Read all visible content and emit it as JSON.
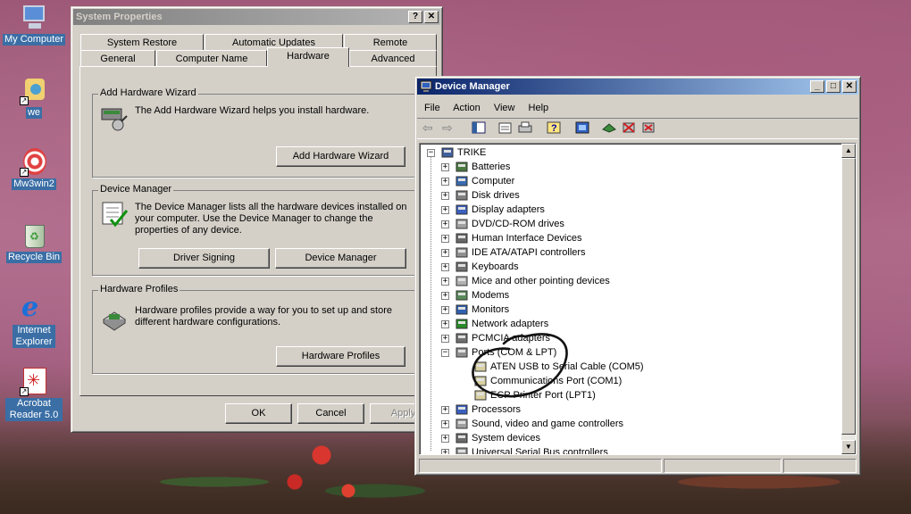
{
  "desktop": {
    "icons": [
      {
        "label": "My Computer"
      },
      {
        "label": "we"
      },
      {
        "label": "Mw3win2"
      },
      {
        "label": "Recycle Bin"
      },
      {
        "label": "Internet Explorer"
      },
      {
        "label": "Acrobat Reader 5.0"
      }
    ]
  },
  "system_properties": {
    "title": "System Properties",
    "tabs_row1": [
      "System Restore",
      "Automatic Updates",
      "Remote"
    ],
    "tabs_row2": [
      "General",
      "Computer Name",
      "Hardware",
      "Advanced"
    ],
    "selected_tab": "Hardware",
    "add_hw": {
      "title": "Add Hardware Wizard",
      "text": "The Add Hardware Wizard helps you install hardware.",
      "button": "Add Hardware Wizard"
    },
    "device_manager": {
      "title": "Device Manager",
      "text": "The Device Manager lists all the hardware devices installed on your computer. Use the Device Manager to change the properties of any device.",
      "button_signing": "Driver Signing",
      "button_dm": "Device Manager"
    },
    "hw_profiles": {
      "title": "Hardware Profiles",
      "text": "Hardware profiles provide a way for you to set up and store different hardware configurations.",
      "button": "Hardware Profiles"
    },
    "ok": "OK",
    "cancel": "Cancel",
    "apply": "Apply"
  },
  "device_manager_window": {
    "title": "Device Manager",
    "menu": [
      "File",
      "Action",
      "View",
      "Help"
    ],
    "root": "TRIKE",
    "categories_top": [
      "Batteries",
      "Computer",
      "Disk drives",
      "Display adapters",
      "DVD/CD-ROM drives",
      "Human Interface Devices",
      "IDE ATA/ATAPI controllers",
      "Keyboards",
      "Mice and other pointing devices",
      "Modems",
      "Monitors",
      "Network adapters",
      "PCMCIA adapters"
    ],
    "ports": {
      "label": "Ports (COM & LPT)",
      "children": [
        "ATEN USB to Serial Cable (COM5)",
        "Communications Port (COM1)",
        "ECP Printer Port (LPT1)"
      ]
    },
    "categories_bottom": [
      "Processors",
      "Sound, video and game controllers",
      "System devices",
      "Universal Serial Bus controllers"
    ]
  }
}
